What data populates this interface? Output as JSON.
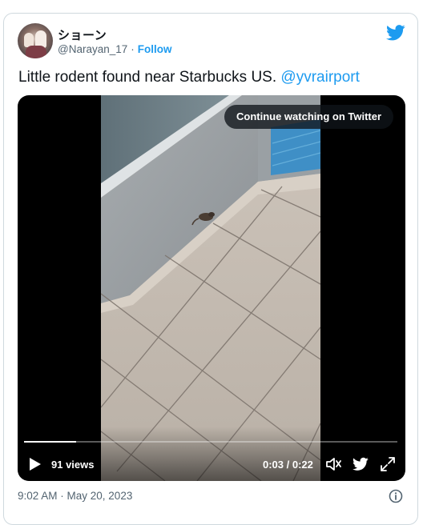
{
  "tweet": {
    "author": {
      "display_name": "ショーン",
      "handle": "@Narayan_17",
      "separator": "·",
      "follow_label": "Follow"
    },
    "text_main": "Little rodent found near Starbucks US.",
    "mention": "@yvrairport",
    "timestamp": "9:02 AM · May 20, 2023"
  },
  "video": {
    "continue_label": "Continue watching on Twitter",
    "views": "91 views",
    "time": "0:03 / 0:22",
    "progress": 0.14
  },
  "icons": {
    "brand": "twitter-bird-icon",
    "play": "play-icon",
    "volume": "volume-icon",
    "twitter_small": "twitter-bird-icon",
    "fullscreen": "fullscreen-icon",
    "info": "info-icon"
  },
  "colors": {
    "accent": "#1d9bf0",
    "text": "#0f1419",
    "secondary": "#536471",
    "border": "#cfd9de"
  }
}
